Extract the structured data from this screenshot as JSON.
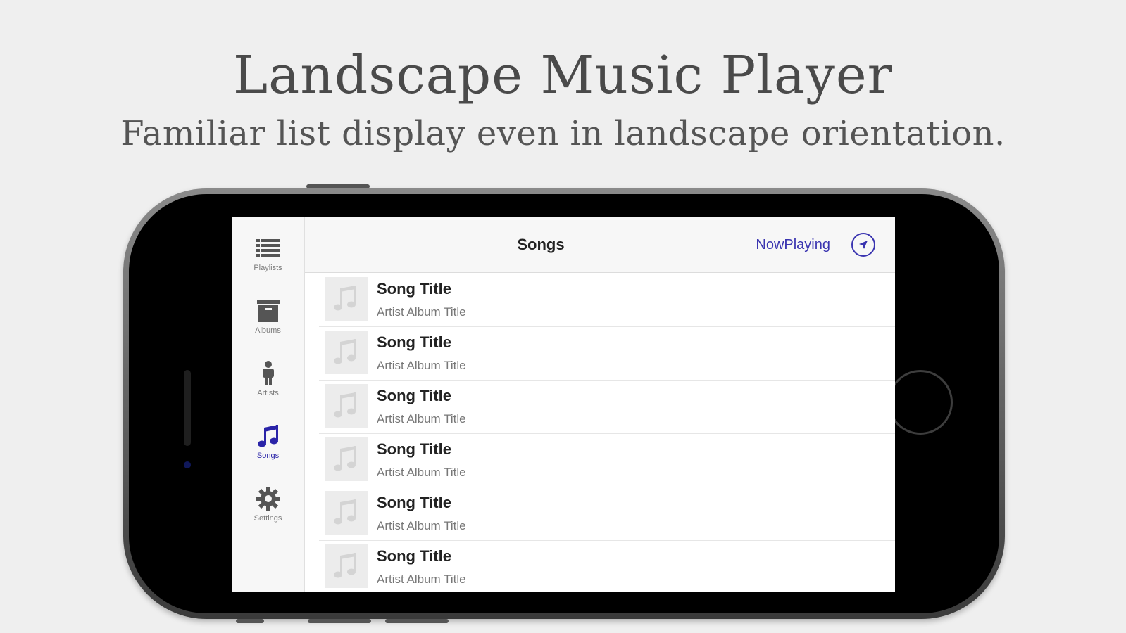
{
  "header": {
    "title": "Landscape Music Player",
    "subtitle": "Familiar list display even in landscape orientation."
  },
  "colors": {
    "accent": "#2a24a8",
    "background": "#efefef",
    "tabbar": "#f7f7f7"
  },
  "tabbar": {
    "items": [
      {
        "label": "Playlists",
        "icon": "list-icon",
        "active": false
      },
      {
        "label": "Albums",
        "icon": "album-box-icon",
        "active": false
      },
      {
        "label": "Artists",
        "icon": "person-icon",
        "active": false
      },
      {
        "label": "Songs",
        "icon": "music-note-icon",
        "active": true
      },
      {
        "label": "Settings",
        "icon": "gear-icon",
        "active": false
      }
    ]
  },
  "navbar": {
    "title": "Songs",
    "now_playing": "NowPlaying",
    "location_icon": "location-arrow-icon"
  },
  "songs": [
    {
      "title": "Song Title",
      "subtitle": "Artist Album Title"
    },
    {
      "title": "Song Title",
      "subtitle": "Artist Album Title"
    },
    {
      "title": "Song Title",
      "subtitle": "Artist Album Title"
    },
    {
      "title": "Song Title",
      "subtitle": "Artist Album Title"
    },
    {
      "title": "Song Title",
      "subtitle": "Artist Album Title"
    },
    {
      "title": "Song Title",
      "subtitle": "Artist Album Title"
    }
  ]
}
